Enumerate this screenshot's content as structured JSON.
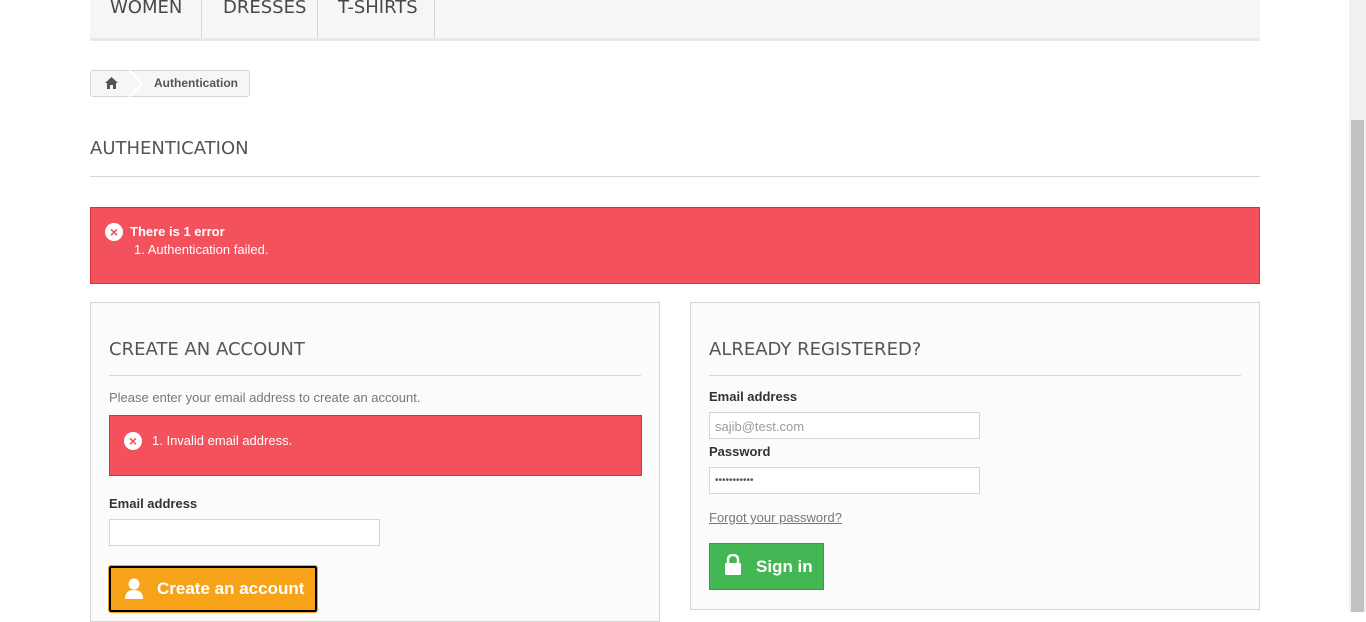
{
  "menu": {
    "items": [
      {
        "label": "WOMEN"
      },
      {
        "label": "DRESSES"
      },
      {
        "label": "T-SHIRTS"
      }
    ]
  },
  "breadcrumb": {
    "home_icon": "home-icon",
    "current": "Authentication"
  },
  "page": {
    "title": "AUTHENTICATION"
  },
  "error": {
    "title": "There is 1 error",
    "items": [
      "1. Authentication failed."
    ]
  },
  "create_account": {
    "title": "CREATE AN ACCOUNT",
    "instructions": "Please enter your email address to create an account.",
    "error": "1. Invalid email address.",
    "email_label": "Email address",
    "email_value": "",
    "button_label": "Create an account",
    "button_icon": "user-icon"
  },
  "login": {
    "title": "ALREADY REGISTERED?",
    "email_label": "Email address",
    "email_value": "sajib@test.com",
    "password_label": "Password",
    "password_value": "•••••••••••",
    "forgot_label": "Forgot your password?",
    "button_label": "Sign in",
    "button_icon": "lock-icon"
  },
  "colors": {
    "error": "#f3515c",
    "orange": "#f7a319",
    "green": "#43b754"
  }
}
